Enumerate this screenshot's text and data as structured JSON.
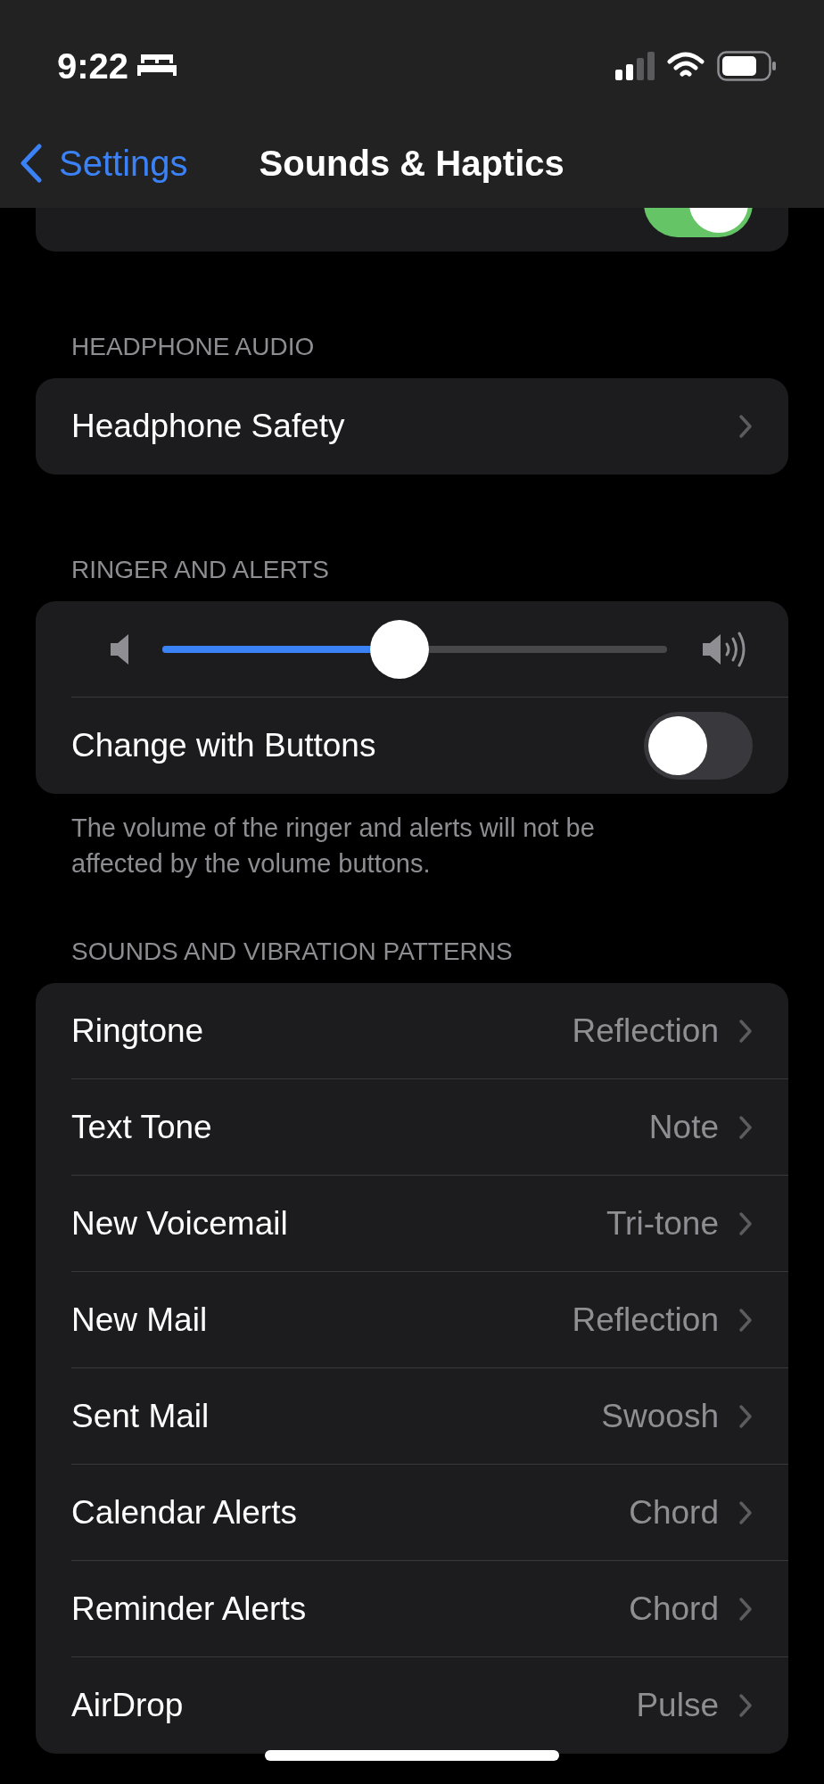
{
  "status_bar": {
    "time": "9:22"
  },
  "nav": {
    "back": "Settings",
    "title": "Sounds & Haptics"
  },
  "sections": [
    {
      "rows": [
        {
          "kind": "cut-toggle",
          "on": true
        }
      ]
    },
    {
      "header": "HEADPHONE AUDIO",
      "rows": [
        {
          "kind": "link",
          "label": "Headphone Safety"
        }
      ]
    },
    {
      "header": "RINGER AND ALERTS",
      "rows": [
        {
          "kind": "slider",
          "level": 0.47
        },
        {
          "kind": "toggle",
          "label": "Change with Buttons",
          "on": false
        }
      ],
      "footer": "The volume of the ringer and alerts will not be affected by the volume buttons."
    },
    {
      "header": "SOUNDS AND VIBRATION PATTERNS",
      "rows": [
        {
          "kind": "link",
          "label": "Ringtone",
          "value": "Reflection"
        },
        {
          "kind": "link",
          "label": "Text Tone",
          "value": "Note"
        },
        {
          "kind": "link",
          "label": "New Voicemail",
          "value": "Tri-tone"
        },
        {
          "kind": "link",
          "label": "New Mail",
          "value": "Reflection"
        },
        {
          "kind": "link",
          "label": "Sent Mail",
          "value": "Swoosh"
        },
        {
          "kind": "link",
          "label": "Calendar Alerts",
          "value": "Chord"
        },
        {
          "kind": "link",
          "label": "Reminder Alerts",
          "value": "Chord"
        },
        {
          "kind": "link",
          "label": "AirDrop",
          "value": "Pulse"
        }
      ]
    }
  ]
}
